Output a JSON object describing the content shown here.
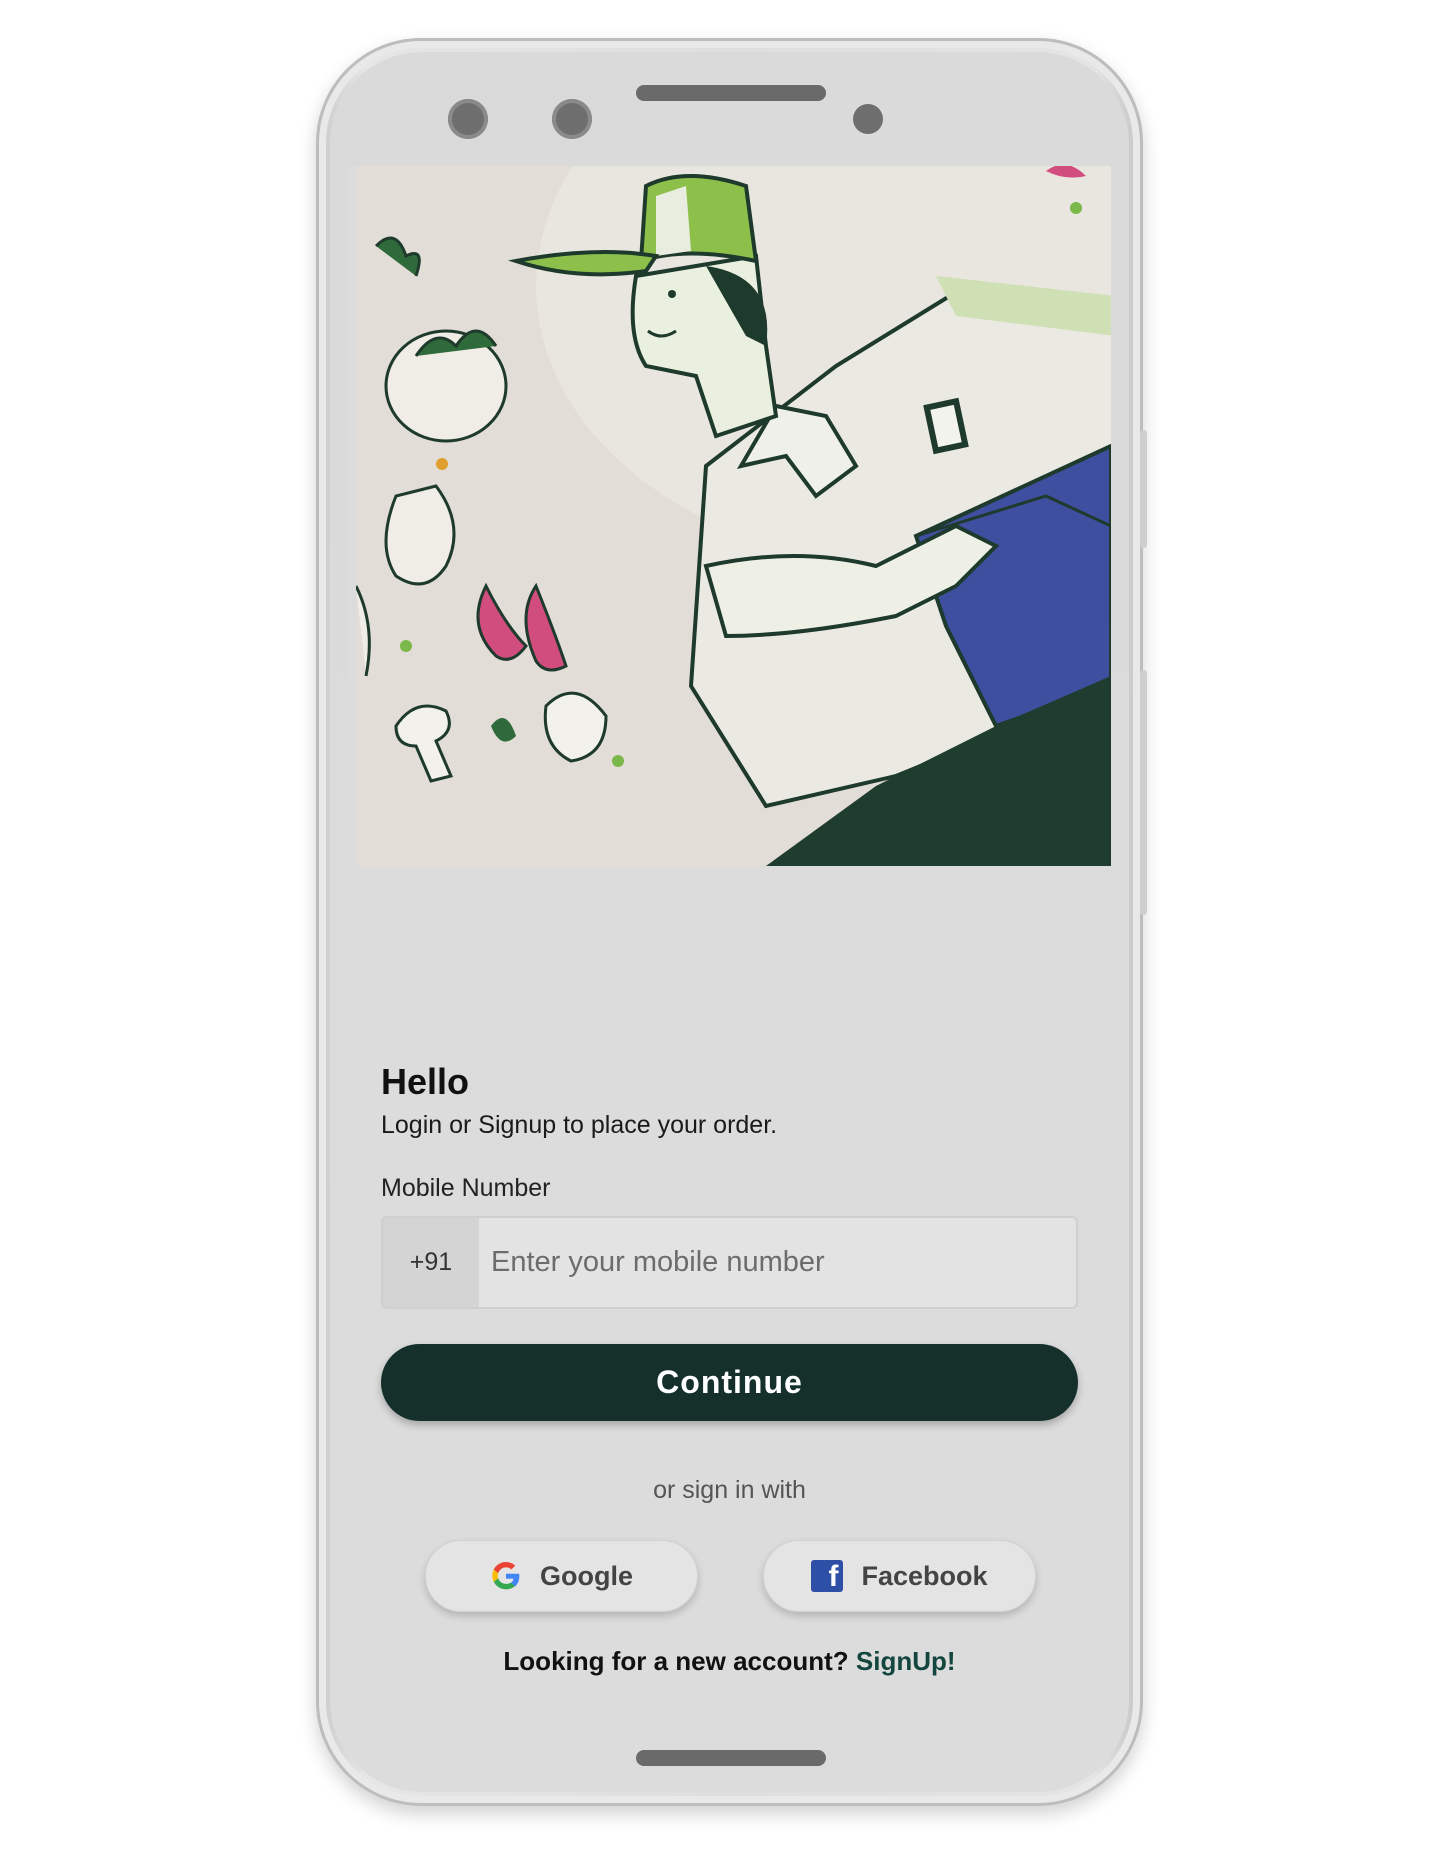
{
  "login": {
    "title": "Hello",
    "subtitle": "Login or Signup to place your order.",
    "mobile_label": "Mobile Number",
    "country_code": "+91",
    "mobile_placeholder": "Enter your mobile number",
    "mobile_value": "",
    "continue_label": "Continue",
    "alt_signin_text": "or sign in with",
    "google_label": "Google",
    "facebook_label": "Facebook",
    "signup_prompt": "Looking for a new account?",
    "signup_link": "SignUp!"
  },
  "hero": {
    "image": "delivery-person-with-box-and-vegetables-illustration"
  },
  "colors": {
    "primary_button": "#15302b",
    "hero_background": "#e2ddd6",
    "cap_green": "#8cc04b",
    "box_blue": "#3f4f9f",
    "facebook_blue": "#2d4fa6"
  },
  "icons": [
    "google-icon",
    "facebook-icon"
  ]
}
